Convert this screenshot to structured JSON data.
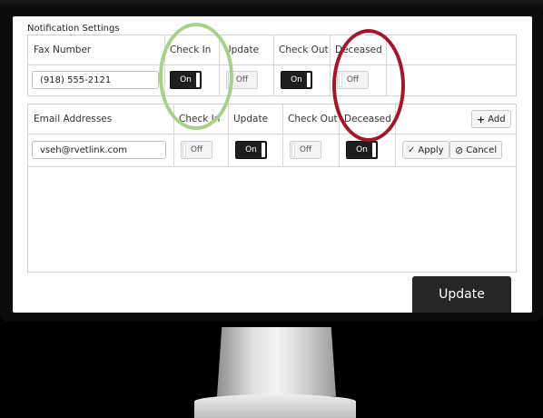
{
  "section_title": "Notification Settings",
  "fax": {
    "headers": [
      "Fax Number",
      "Check In",
      "Update",
      "Check Out",
      "Deceased"
    ],
    "number": "(918) 555-2121",
    "toggles": [
      {
        "name": "check-in",
        "label": "On",
        "state": "on"
      },
      {
        "name": "update",
        "label": "Off",
        "state": "off"
      },
      {
        "name": "check-out",
        "label": "On",
        "state": "on"
      },
      {
        "name": "deceased",
        "label": "Off",
        "state": "off"
      }
    ]
  },
  "email": {
    "headers": [
      "Email Addresses",
      "Check In",
      "Update",
      "Check Out",
      "Deceased"
    ],
    "add_label": "Add",
    "address": "vseh@rvetlink.com",
    "toggles": [
      {
        "name": "check-in",
        "label": "Off",
        "state": "off"
      },
      {
        "name": "update",
        "label": "On",
        "state": "on"
      },
      {
        "name": "check-out",
        "label": "Off",
        "state": "off"
      },
      {
        "name": "deceased",
        "label": "On",
        "state": "on"
      }
    ],
    "apply_label": "Apply",
    "cancel_label": "Cancel"
  },
  "update_label": "Update",
  "annotations": {
    "green_circle_color": "#a7d18a",
    "red_circle_color": "#a0192a"
  }
}
